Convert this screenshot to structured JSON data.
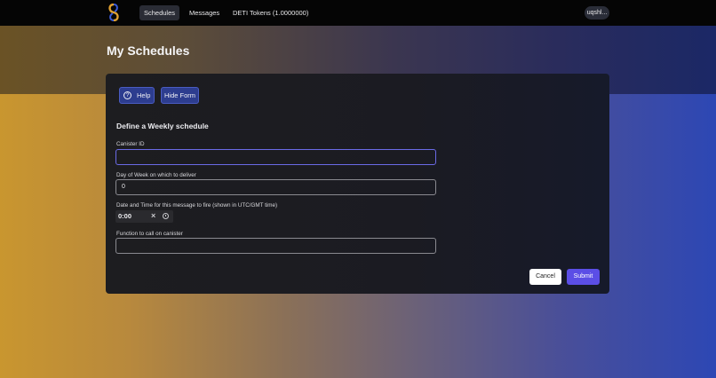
{
  "nav": {
    "items": [
      {
        "label": "Schedules",
        "active": true
      },
      {
        "label": "Messages",
        "active": false
      },
      {
        "label": "DETI Tokens (1.0000000)",
        "active": false
      }
    ],
    "user_label": "uqshl..."
  },
  "page": {
    "title": "My Schedules"
  },
  "form": {
    "help_label": "Help",
    "hide_form_label": "Hide Form",
    "section_title": "Define a Weekly schedule",
    "canister_id": {
      "label": "Canister ID",
      "value": ""
    },
    "day_of_week": {
      "label": "Day of Week on which to deliver",
      "value": "0"
    },
    "datetime": {
      "label": "Date and Time for this message to fire (shown in UTC/GMT time)",
      "value": "0:00"
    },
    "function": {
      "label": "Function to call on canister",
      "value": ""
    },
    "cancel_label": "Cancel",
    "submit_label": "Submit"
  },
  "colors": {
    "accent": "#5b4ee6",
    "button_blue": "#2d3d8f"
  }
}
